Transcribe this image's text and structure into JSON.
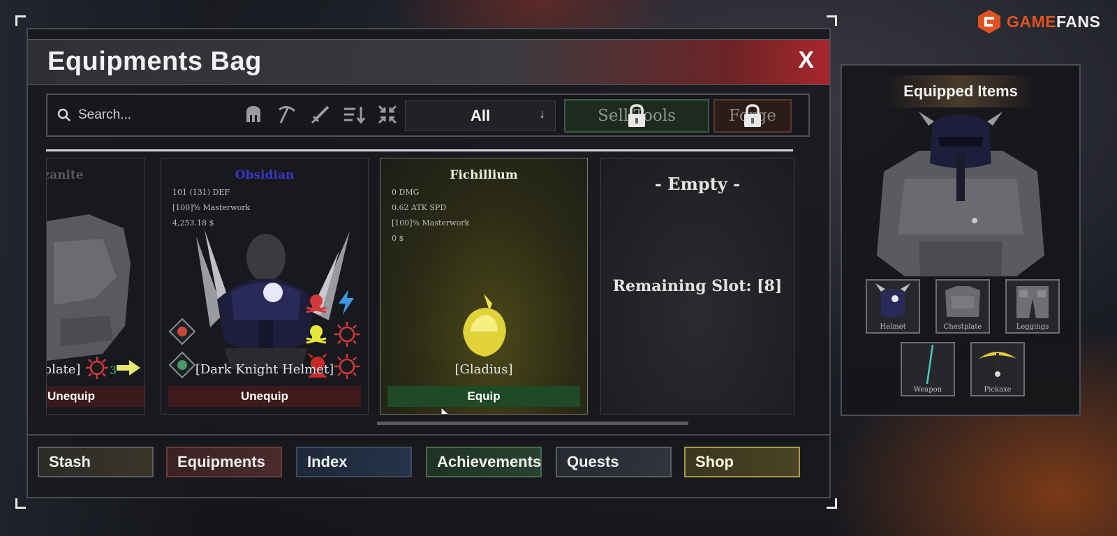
{
  "brand": {
    "name_part1": "GAME",
    "name_part2": "FANS",
    "color1": "#e0521f",
    "color2": "#f2f2f2"
  },
  "window": {
    "title": "Equipments Bag",
    "close_label": "X"
  },
  "toolbar": {
    "search_placeholder": "Search...",
    "filter_icons": [
      "helmet-icon",
      "pickaxe-icon",
      "sword-icon",
      "sort-icon",
      "collapse-icon"
    ],
    "category_selected": "All",
    "sell_label": "Sell Tools",
    "forge_label": "Forge"
  },
  "items": [
    {
      "name": "Tanzanite",
      "item_name": "[Chestplate]",
      "count_badge": "3",
      "action": "Unequip",
      "status": "equipped"
    },
    {
      "name": "Obsidian",
      "stats": [
        "101 (131) DEF",
        "[100]% Masterwork",
        "4,253.18 $"
      ],
      "item_name": "[Dark Knight Helmet]",
      "action": "Unequip",
      "status": "equipped",
      "name_color": "#3a36c8"
    },
    {
      "name": "Fichillium",
      "stats": [
        "0 DMG",
        "0.62 ATK SPD",
        "[100]% Masterwork",
        "0 $"
      ],
      "item_name": "[Gladius]",
      "action": "Equip",
      "status": "selected",
      "name_color": "#f0f0e0"
    }
  ],
  "empty_slot": {
    "label": "- Empty -",
    "remaining": "Remaining Slot: [8]"
  },
  "tabs": [
    "Stash",
    "Equipments",
    "Index",
    "Achievements",
    "Quests",
    "Shop"
  ],
  "equipped": {
    "title": "Equipped Items",
    "slots": [
      "Helmet",
      "Chestplate",
      "Leggings",
      "Weapon",
      "Pickaxe"
    ]
  },
  "colors": {
    "equip_green": "#1e4a26",
    "unequip_red": "#3e1a1c",
    "accent_gold": "#a89a4c"
  }
}
